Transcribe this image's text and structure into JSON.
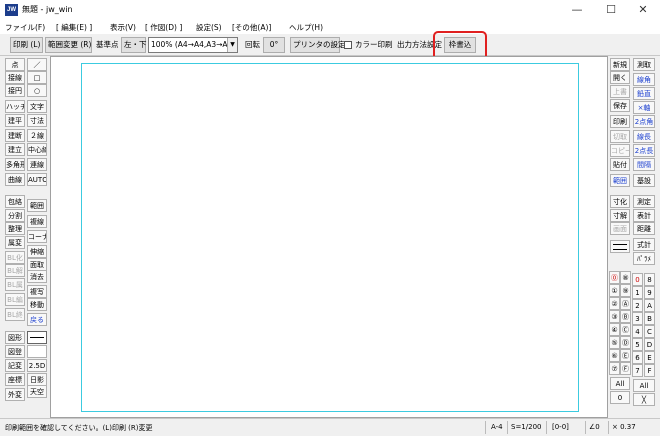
{
  "window": {
    "icon_text": "JW",
    "title": "無題 - jw_win",
    "minimize": "—",
    "maximize": "☐",
    "close": "✕"
  },
  "menu": [
    "ファイル(F)",
    "[ 編集(E) ]",
    "表示(V)",
    "[ 作図(D) ]",
    "設定(S)",
    "[その他(A)]",
    "ヘルプ(H)"
  ],
  "toolbar": {
    "print": "印刷 (L)",
    "range_change": "範囲変更 (R)",
    "base_point_label": "基準点",
    "base_point_value": "左・下",
    "paper_size": "100% (A4→A4,A3→A3)",
    "rotate_label": "回転",
    "rotate_value": "0°",
    "printer_settings": "プリンタの設定",
    "color_print": "カラー印刷",
    "output_settings": "出力方法設定",
    "print_to_file": "枠書込"
  },
  "left_tools": [
    [
      "点",
      "／"
    ],
    [
      "接線",
      "□"
    ],
    [
      "接円",
      "○"
    ],
    [
      "ハッチ",
      "文字"
    ],
    [
      "建平",
      "寸法"
    ],
    [
      "建断",
      "２線"
    ],
    [
      "建立",
      "中心線"
    ],
    [
      "多角形",
      "連線"
    ],
    [
      "曲線",
      "AUTO"
    ],
    [
      "包絡",
      "範囲"
    ],
    [
      "分割",
      "複線"
    ],
    [
      "整理",
      "コーナー"
    ],
    [
      "属変",
      "伸縮"
    ],
    [
      "BL化",
      "面取"
    ],
    [
      "BL解",
      "消去"
    ],
    [
      "BL属",
      "複写"
    ],
    [
      "BL編",
      "移動"
    ],
    [
      "BL終",
      "戻る"
    ],
    [
      "図形",
      ""
    ],
    [
      "図登",
      ""
    ],
    [
      "記変",
      "2.5D"
    ],
    [
      "座標",
      "日影"
    ],
    [
      "外変",
      "天空"
    ]
  ],
  "right_tools": [
    [
      "新規",
      "測取"
    ],
    [
      "開く",
      "線角"
    ],
    [
      "上書",
      "鉛直"
    ],
    [
      "保存",
      "×軸"
    ],
    [
      "印刷",
      "2点角"
    ],
    [
      "切取",
      "線長"
    ],
    [
      "コピー",
      "2点長"
    ],
    [
      "貼付",
      "間隔"
    ],
    [
      "範囲",
      "基設"
    ],
    [
      "寸化",
      "測定"
    ],
    [
      "寸解",
      "表計"
    ],
    [
      "画面",
      "距離"
    ],
    [
      "",
      "式計"
    ],
    [
      "",
      "ﾊﾟﾗﾒ"
    ]
  ],
  "layers": {
    "left": [
      "⓪",
      "①",
      "②",
      "③",
      "④",
      "⑤",
      "⑥",
      "⑦"
    ],
    "mid": [
      "⑧",
      "⑨",
      "Ⓐ",
      "Ⓑ",
      "Ⓒ",
      "Ⓓ",
      "Ⓔ",
      "Ⓕ"
    ],
    "right": [
      "0",
      "1",
      "2",
      "3",
      "4",
      "5",
      "6",
      "7"
    ],
    "right2": [
      "8",
      "9",
      "A",
      "B",
      "C",
      "D",
      "E",
      "F"
    ],
    "all_left": "All",
    "all_right": "All",
    "zero": "0",
    "cross": "╳"
  },
  "status": {
    "message": "印刷範囲を確認してください。(L)印刷 (R)変更",
    "paper": "A-4",
    "scale": "S=1/200",
    "layer": "[0-0]",
    "angle": "∠0",
    "zoom": "× 0.37"
  }
}
